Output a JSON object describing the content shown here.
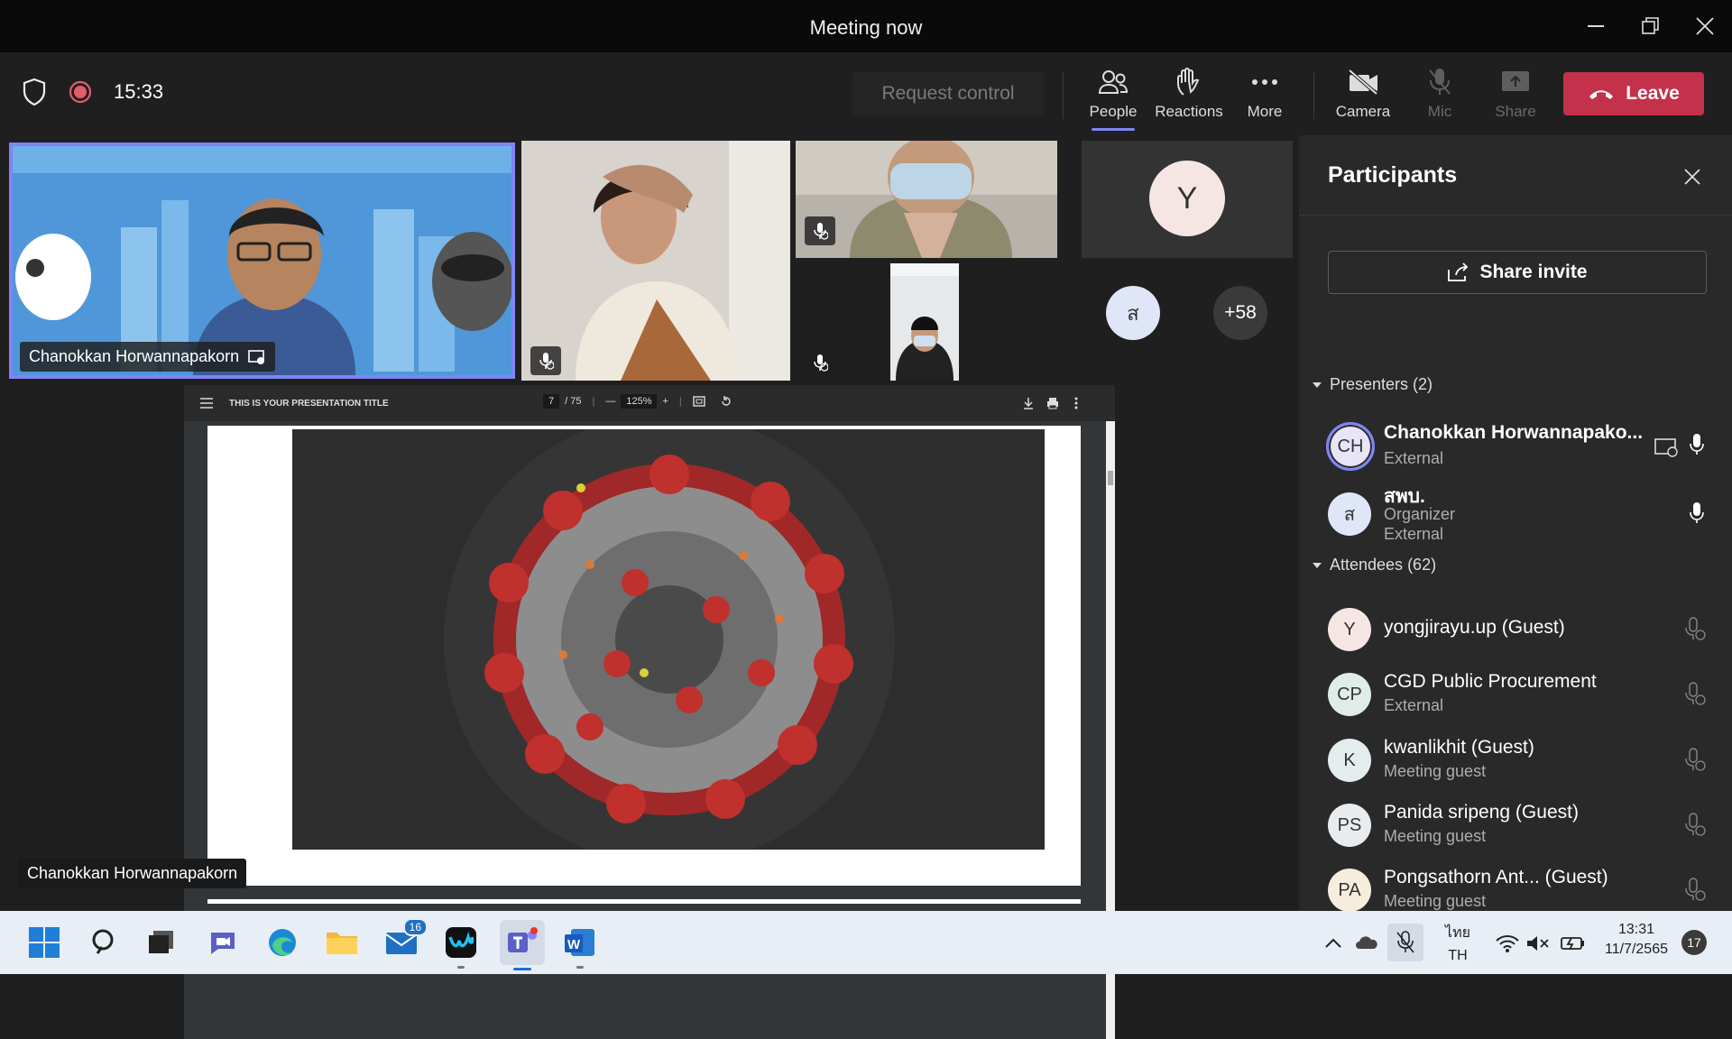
{
  "window": {
    "title": "Meeting now"
  },
  "toolbar": {
    "timer": "15:33",
    "request_control": "Request control",
    "people": "People",
    "reactions": "Reactions",
    "more": "More",
    "camera": "Camera",
    "mic": "Mic",
    "share": "Share",
    "leave": "Leave"
  },
  "stage": {
    "featured_name": "Chanokkan Horwannapakorn",
    "presenter_label": "Chanokkan Horwannapakorn",
    "avatar_y": "Y",
    "avatar_s": "ส",
    "overflow_count": "+58",
    "pdf": {
      "title": "THIS IS YOUR PRESENTATION TITLE",
      "page_current": "7",
      "page_total": "/ 75",
      "zoom": "125%"
    }
  },
  "participants": {
    "title": "Participants",
    "share_invite": "Share invite",
    "presenters_header": "Presenters (2)",
    "attendees_header": "Attendees (62)",
    "presenters": [
      {
        "initials": "CH",
        "name": "Chanokkan Horwannapako...",
        "role": "External",
        "color": "#e8e5f6"
      },
      {
        "initials": "ส",
        "name": "สพบ.",
        "role": "Organizer",
        "role2": "External",
        "color": "#dfe6f7"
      }
    ],
    "attendees": [
      {
        "initials": "Y",
        "name": "yongjirayu.up (Guest)",
        "role": "",
        "color": "#f5e6e4"
      },
      {
        "initials": "CP",
        "name": "CGD Public Procurement",
        "role": "External",
        "color": "#e0ece7"
      },
      {
        "initials": "K",
        "name": "kwanlikhit (Guest)",
        "role": "Meeting guest",
        "color": "#e4ecee"
      },
      {
        "initials": "PS",
        "name": "Panida sripeng (Guest)",
        "role": "Meeting guest",
        "color": "#e9ecef"
      },
      {
        "initials": "PA",
        "name": "Pongsathorn Ant... (Guest)",
        "role": "Meeting guest",
        "color": "#f6eddd"
      }
    ]
  },
  "taskbar": {
    "mail_badge": "16",
    "lang_top": "ไทย",
    "lang_bottom": "TH",
    "time": "13:31",
    "date": "11/7/2565",
    "notif_count": "17"
  },
  "colors": {
    "accent": "#7f85f5",
    "leave": "#c4314b",
    "bg": "#1f1f1f",
    "panel": "#292929"
  }
}
